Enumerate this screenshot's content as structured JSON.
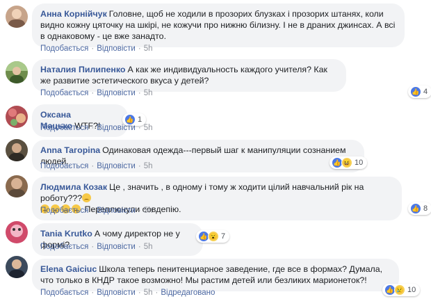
{
  "comments": [
    {
      "author": "Анна Корнійчук",
      "text": "Головне, щоб не ходили в прозорих блузках і прозорих штанях, коли видно кожну цяточку на шкірі, не кожучи про нижню білизну. І не в драних джинсах. А всі в однаковому - це вже занадто.",
      "like": "Подобається",
      "reply": "Відповісти",
      "time": "5h",
      "avatar_color": "#c7a48a"
    },
    {
      "author": "Наталия Пилипенко",
      "text": "А как же индивидуальность каждого учителя? Как же развитие эстетического вкуса у детей?",
      "like": "Подобається",
      "reply": "Відповісти",
      "time": "5h",
      "reaction_count": "4",
      "avatar_color": "#6f8d4c"
    },
    {
      "author": "Оксана Мацько",
      "text": "WTF?!",
      "like": "Подобається",
      "reply": "Відповісти",
      "time": "5h",
      "reaction_count": "1",
      "avatar_color": "#b04c52"
    },
    {
      "author": "Anna Taгopina",
      "text": "Одинаковая одежда---первый шаг к манипуляции сознанием людей.",
      "like": "Подобається",
      "reply": "Відповісти",
      "time": "5h",
      "reaction_count": "10",
      "avatar_color": "#5a5040"
    },
    {
      "author": "Людмила Козак",
      "text": "Це , значить , в одному і тому ж ходити цілий навчальний рік на роботу???",
      "text2": "Переплюнули совдепію.",
      "like": "Подобається",
      "reply": "Відповісти",
      "time": "5h",
      "reaction_count": "8",
      "avatar_color": "#8a6a4e"
    },
    {
      "author": "Tania Krutko",
      "text": "А чому директор не у формі?",
      "like": "Подобається",
      "reply": "Відповісти",
      "time": "5h",
      "reaction_count": "7",
      "avatar_color": "#d04a6a"
    },
    {
      "author": "Elena Gaiciuc",
      "text": "Школа теперь пенитенциарное заведение, где все в формах? Думала, что только в КНДР такое возможно! Мы растим детей или безликих марионеток?!",
      "like": "Подобається",
      "reply": "Відповісти",
      "time": "5h",
      "edited": "Відредаговано",
      "reaction_count": "10",
      "avatar_color": "#3c4a5c"
    }
  ],
  "colors": {
    "author": "#385898",
    "action_link": "#4b67a1",
    "bubble_bg": "#f2f3f5",
    "like_blue": "#4b78e6"
  }
}
